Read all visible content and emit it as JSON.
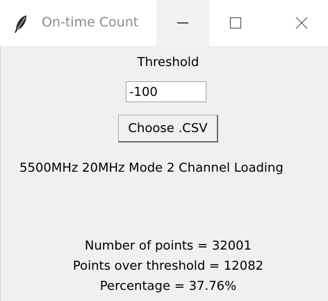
{
  "window": {
    "title": "On-time Count",
    "icons": {
      "app": "feather-icon",
      "minimize": "minimize-icon",
      "maximize": "maximize-icon",
      "close": "close-icon"
    }
  },
  "form": {
    "threshold_label": "Threshold",
    "threshold_value": "-100",
    "choose_button_label": "Choose .CSV",
    "file_label": "5500MHz 20MHz Mode 2 Channel Loading"
  },
  "results": {
    "points_text": "Number of points = 32001",
    "over_text": "Points over threshold = 12082",
    "percentage_text": "Percentage = 37.76%"
  },
  "colors": {
    "window_bg": "#f0f0f0",
    "titlebar_bg": "#ffffff",
    "title_text": "#8a8a8a"
  }
}
